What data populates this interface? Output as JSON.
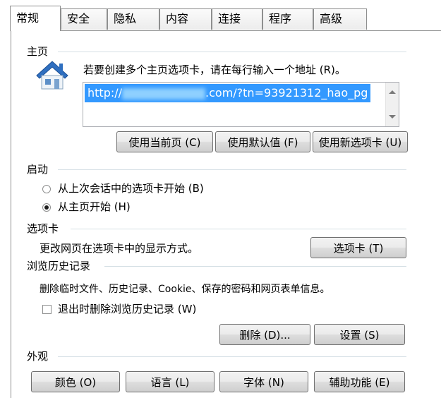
{
  "tabs": [
    {
      "label": "常规",
      "active": true
    },
    {
      "label": "安全"
    },
    {
      "label": "隐私"
    },
    {
      "label": "内容"
    },
    {
      "label": "连接"
    },
    {
      "label": "程序"
    },
    {
      "label": "高级"
    }
  ],
  "home": {
    "group_label": "主页",
    "instruction": "若要创建多个主页选项卡，请在每行输入一个地址 (R)。",
    "url_prefix": "http://",
    "url_suffix": ".com/?tn=93921312_hao_pg",
    "buttons": {
      "use_current": "使用当前页 (C)",
      "use_default": "使用默认值 (F)",
      "use_new_tab": "使用新选项卡 (U)"
    }
  },
  "startup": {
    "group_label": "启动",
    "options": [
      {
        "label": "从上次会话中的选项卡开始 (B)",
        "selected": false
      },
      {
        "label": "从主页开始 (H)",
        "selected": true
      }
    ]
  },
  "tabs_section": {
    "group_label": "选项卡",
    "description": "更改网页在选项卡中的显示方式。",
    "button": "选项卡 (T)"
  },
  "history": {
    "group_label": "浏览历史记录",
    "description": "删除临时文件、历史记录、Cookie、保存的密码和网页表单信息。",
    "checkbox_label": "退出时删除浏览历史记录 (W)",
    "checkbox_checked": false,
    "delete_button": "删除 (D)...",
    "settings_button": "设置 (S)"
  },
  "appearance": {
    "group_label": "外观",
    "buttons": {
      "colors": "颜色 (O)",
      "languages": "语言 (L)",
      "fonts": "字体 (N)",
      "accessibility": "辅助功能 (E)"
    }
  },
  "colors": {
    "selection": "#3399ff",
    "border": "#8e8f8f",
    "rule": "#d5dfe5"
  }
}
